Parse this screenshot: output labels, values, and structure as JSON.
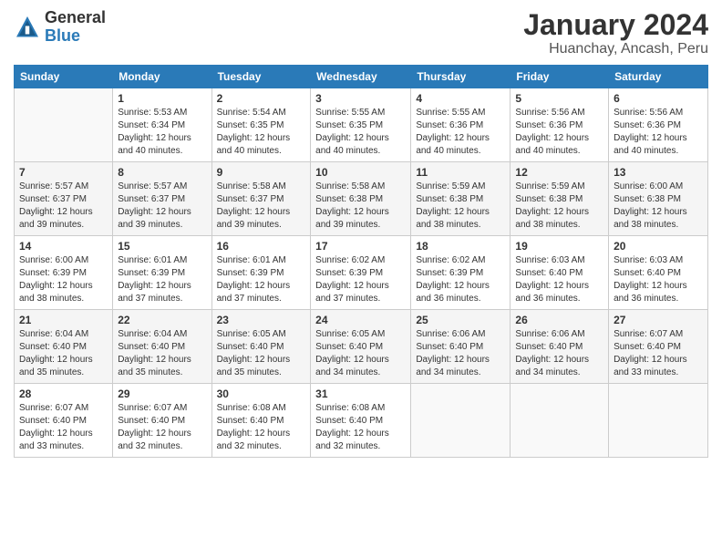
{
  "header": {
    "logo": {
      "general": "General",
      "blue": "Blue"
    },
    "title": "January 2024",
    "subtitle": "Huanchay, Ancash, Peru"
  },
  "calendar": {
    "days_of_week": [
      "Sunday",
      "Monday",
      "Tuesday",
      "Wednesday",
      "Thursday",
      "Friday",
      "Saturday"
    ],
    "weeks": [
      [
        {
          "day": "",
          "detail": ""
        },
        {
          "day": "1",
          "detail": "Sunrise: 5:53 AM\nSunset: 6:34 PM\nDaylight: 12 hours\nand 40 minutes."
        },
        {
          "day": "2",
          "detail": "Sunrise: 5:54 AM\nSunset: 6:35 PM\nDaylight: 12 hours\nand 40 minutes."
        },
        {
          "day": "3",
          "detail": "Sunrise: 5:55 AM\nSunset: 6:35 PM\nDaylight: 12 hours\nand 40 minutes."
        },
        {
          "day": "4",
          "detail": "Sunrise: 5:55 AM\nSunset: 6:36 PM\nDaylight: 12 hours\nand 40 minutes."
        },
        {
          "day": "5",
          "detail": "Sunrise: 5:56 AM\nSunset: 6:36 PM\nDaylight: 12 hours\nand 40 minutes."
        },
        {
          "day": "6",
          "detail": "Sunrise: 5:56 AM\nSunset: 6:36 PM\nDaylight: 12 hours\nand 40 minutes."
        }
      ],
      [
        {
          "day": "7",
          "detail": "Sunrise: 5:57 AM\nSunset: 6:37 PM\nDaylight: 12 hours\nand 39 minutes."
        },
        {
          "day": "8",
          "detail": "Sunrise: 5:57 AM\nSunset: 6:37 PM\nDaylight: 12 hours\nand 39 minutes."
        },
        {
          "day": "9",
          "detail": "Sunrise: 5:58 AM\nSunset: 6:37 PM\nDaylight: 12 hours\nand 39 minutes."
        },
        {
          "day": "10",
          "detail": "Sunrise: 5:58 AM\nSunset: 6:38 PM\nDaylight: 12 hours\nand 39 minutes."
        },
        {
          "day": "11",
          "detail": "Sunrise: 5:59 AM\nSunset: 6:38 PM\nDaylight: 12 hours\nand 38 minutes."
        },
        {
          "day": "12",
          "detail": "Sunrise: 5:59 AM\nSunset: 6:38 PM\nDaylight: 12 hours\nand 38 minutes."
        },
        {
          "day": "13",
          "detail": "Sunrise: 6:00 AM\nSunset: 6:38 PM\nDaylight: 12 hours\nand 38 minutes."
        }
      ],
      [
        {
          "day": "14",
          "detail": "Sunrise: 6:00 AM\nSunset: 6:39 PM\nDaylight: 12 hours\nand 38 minutes."
        },
        {
          "day": "15",
          "detail": "Sunrise: 6:01 AM\nSunset: 6:39 PM\nDaylight: 12 hours\nand 37 minutes."
        },
        {
          "day": "16",
          "detail": "Sunrise: 6:01 AM\nSunset: 6:39 PM\nDaylight: 12 hours\nand 37 minutes."
        },
        {
          "day": "17",
          "detail": "Sunrise: 6:02 AM\nSunset: 6:39 PM\nDaylight: 12 hours\nand 37 minutes."
        },
        {
          "day": "18",
          "detail": "Sunrise: 6:02 AM\nSunset: 6:39 PM\nDaylight: 12 hours\nand 36 minutes."
        },
        {
          "day": "19",
          "detail": "Sunrise: 6:03 AM\nSunset: 6:40 PM\nDaylight: 12 hours\nand 36 minutes."
        },
        {
          "day": "20",
          "detail": "Sunrise: 6:03 AM\nSunset: 6:40 PM\nDaylight: 12 hours\nand 36 minutes."
        }
      ],
      [
        {
          "day": "21",
          "detail": "Sunrise: 6:04 AM\nSunset: 6:40 PM\nDaylight: 12 hours\nand 35 minutes."
        },
        {
          "day": "22",
          "detail": "Sunrise: 6:04 AM\nSunset: 6:40 PM\nDaylight: 12 hours\nand 35 minutes."
        },
        {
          "day": "23",
          "detail": "Sunrise: 6:05 AM\nSunset: 6:40 PM\nDaylight: 12 hours\nand 35 minutes."
        },
        {
          "day": "24",
          "detail": "Sunrise: 6:05 AM\nSunset: 6:40 PM\nDaylight: 12 hours\nand 34 minutes."
        },
        {
          "day": "25",
          "detail": "Sunrise: 6:06 AM\nSunset: 6:40 PM\nDaylight: 12 hours\nand 34 minutes."
        },
        {
          "day": "26",
          "detail": "Sunrise: 6:06 AM\nSunset: 6:40 PM\nDaylight: 12 hours\nand 34 minutes."
        },
        {
          "day": "27",
          "detail": "Sunrise: 6:07 AM\nSunset: 6:40 PM\nDaylight: 12 hours\nand 33 minutes."
        }
      ],
      [
        {
          "day": "28",
          "detail": "Sunrise: 6:07 AM\nSunset: 6:40 PM\nDaylight: 12 hours\nand 33 minutes."
        },
        {
          "day": "29",
          "detail": "Sunrise: 6:07 AM\nSunset: 6:40 PM\nDaylight: 12 hours\nand 32 minutes."
        },
        {
          "day": "30",
          "detail": "Sunrise: 6:08 AM\nSunset: 6:40 PM\nDaylight: 12 hours\nand 32 minutes."
        },
        {
          "day": "31",
          "detail": "Sunrise: 6:08 AM\nSunset: 6:40 PM\nDaylight: 12 hours\nand 32 minutes."
        },
        {
          "day": "",
          "detail": ""
        },
        {
          "day": "",
          "detail": ""
        },
        {
          "day": "",
          "detail": ""
        }
      ]
    ]
  }
}
